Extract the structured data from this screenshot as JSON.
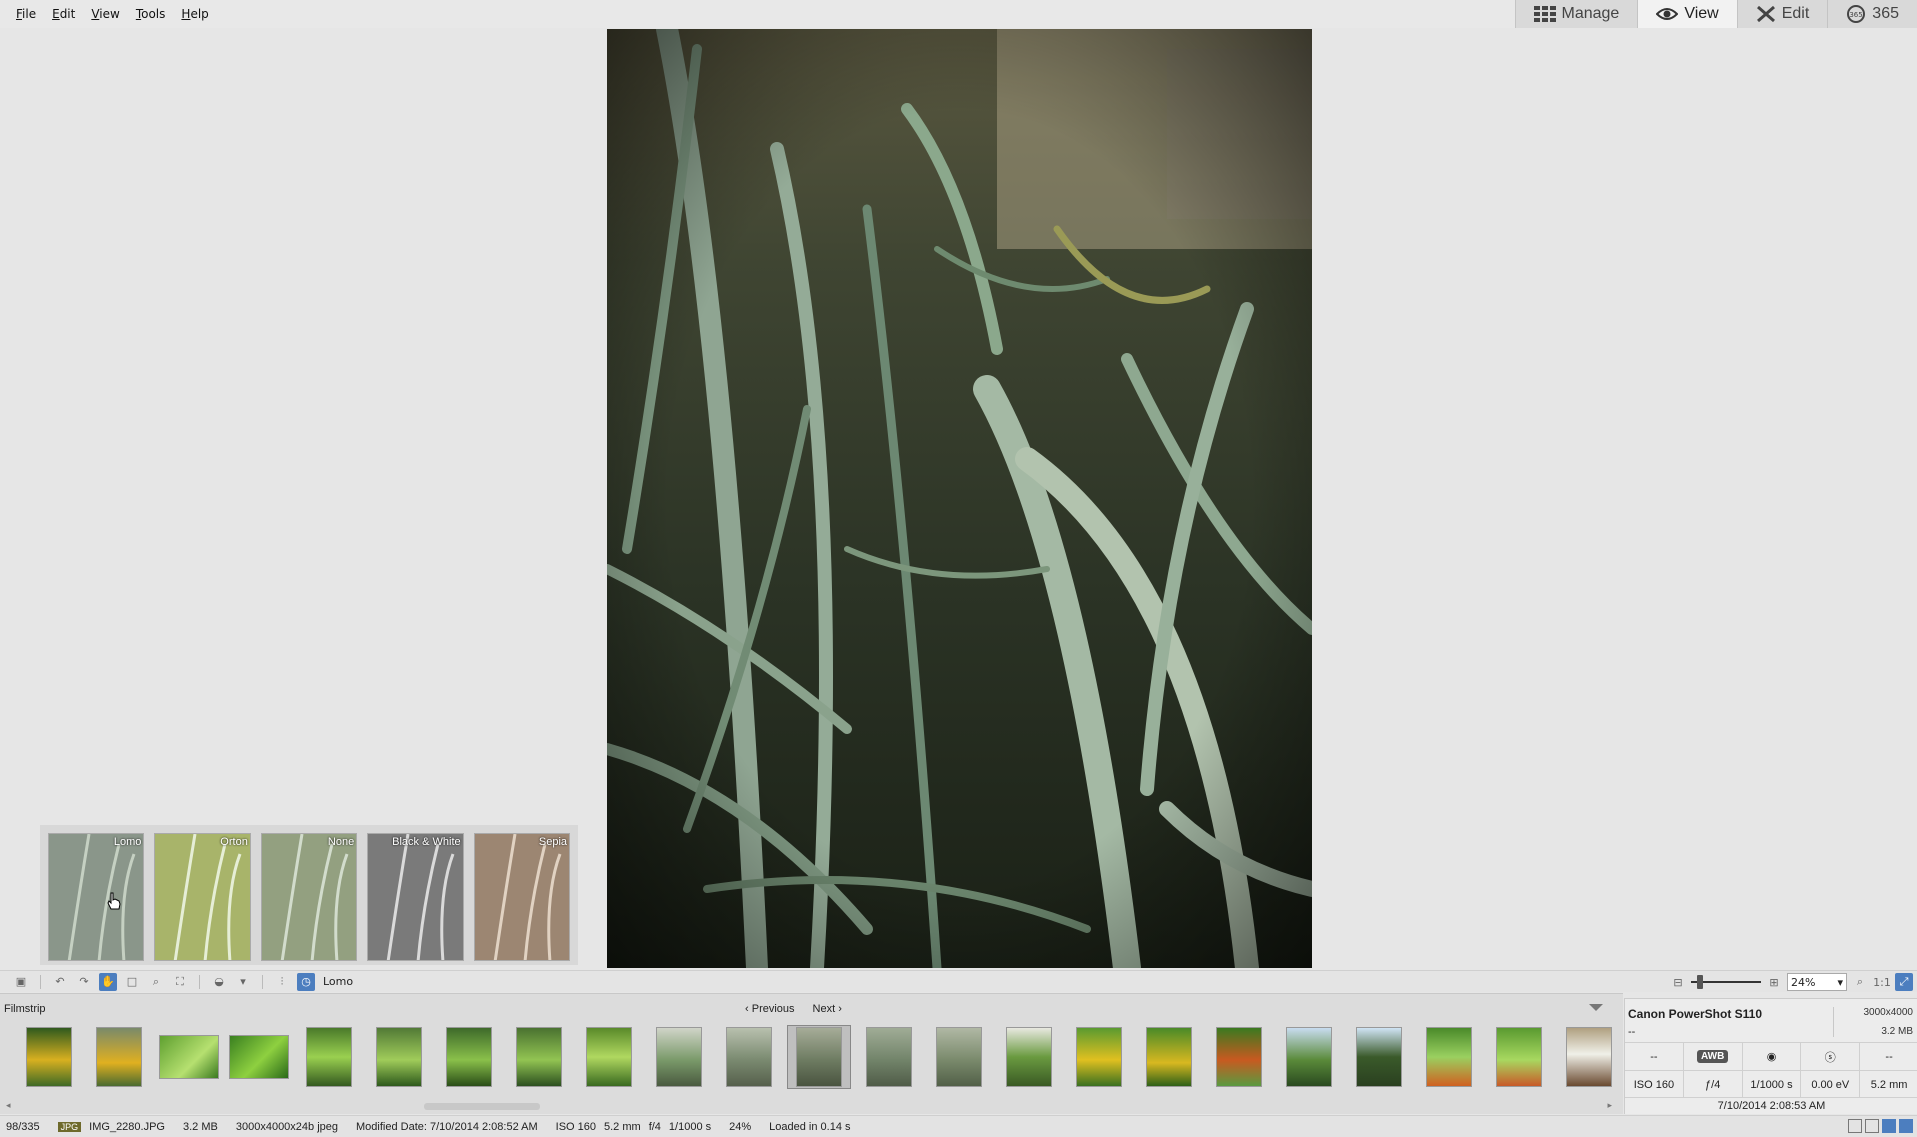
{
  "menu": [
    "File",
    "Edit",
    "View",
    "Tools",
    "Help"
  ],
  "modes": [
    {
      "label": "Manage",
      "icon": "grid-icon",
      "active": false
    },
    {
      "label": "View",
      "icon": "eye-icon",
      "active": true
    },
    {
      "label": "Edit",
      "icon": "tools-icon",
      "active": false
    },
    {
      "label": "365",
      "icon": "365-icon",
      "active": false
    }
  ],
  "presets": [
    {
      "label": "Lomo",
      "tint": "#8a968a"
    },
    {
      "label": "Orton",
      "tint": "#a8b46a"
    },
    {
      "label": "None",
      "tint": "#93a080"
    },
    {
      "label": "Black & White",
      "tint": "#7a7a7a"
    },
    {
      "label": "Sepia",
      "tint": "#9c8672"
    }
  ],
  "toolbar": {
    "active_preset": "Lomo",
    "zoom": "24%"
  },
  "filmstrip": {
    "title": "Filmstrip",
    "previous": "Previous",
    "next": "Next"
  },
  "info": {
    "camera": "Canon PowerShot S110",
    "dimensions": "3000x4000",
    "lens": "--",
    "size": "3.2 MB",
    "row1": [
      "--",
      "AWB",
      "",
      "",
      "--"
    ],
    "row2": [
      "ISO 160",
      "ƒ/4",
      "1/1000 s",
      "0.00 eV",
      "5.2 mm"
    ],
    "date": "7/10/2014 2:08:53 AM"
  },
  "status": {
    "position": "98/335",
    "format": "JPG",
    "filename": "IMG_2280.JPG",
    "filesize": "3.2 MB",
    "info": "3000x4000x24b jpeg",
    "modified": "Modified Date: 7/10/2014 2:08:52 AM",
    "iso": "ISO 160",
    "focal": "5.2 mm",
    "aperture": "f/4",
    "shutter": "1/1000 s",
    "zoom": "24%",
    "loaded": "Loaded in 0.14 s"
  }
}
